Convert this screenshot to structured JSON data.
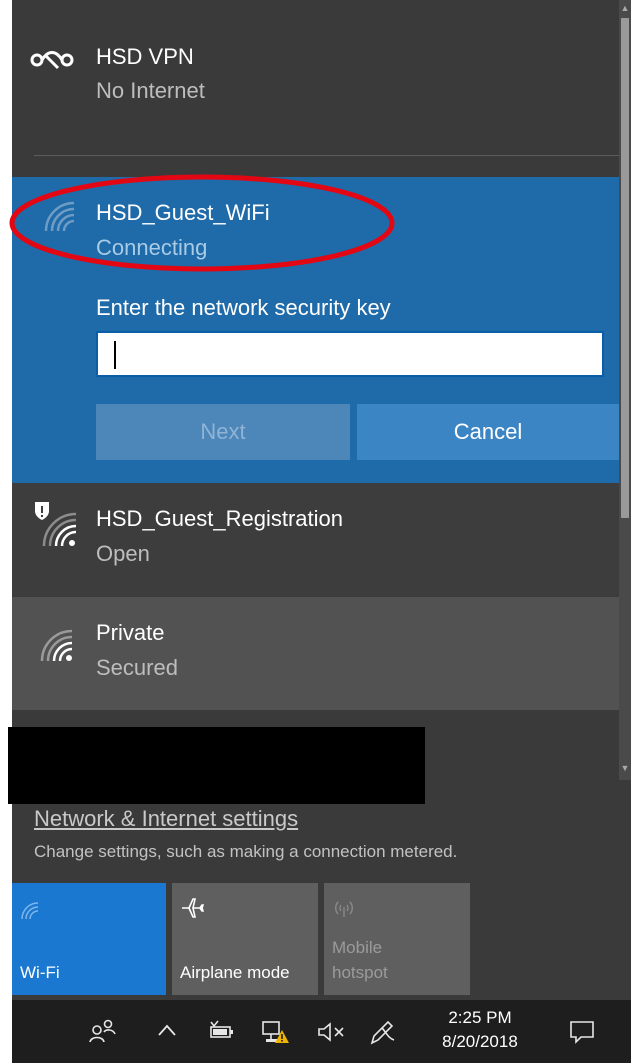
{
  "networks": {
    "vpn": {
      "name": "HSD VPN",
      "status": "No Internet",
      "icon": "vpn-icon"
    },
    "connecting": {
      "name": "HSD_Guest_WiFi",
      "status": "Connecting",
      "icon": "wifi-signal-icon",
      "key_label": "Enter the network security key",
      "key_value": "",
      "next_label": "Next",
      "cancel_label": "Cancel"
    },
    "registration": {
      "name": "HSD_Guest_Registration",
      "status": "Open",
      "icon": "wifi-shield-icon"
    },
    "private": {
      "name": "Private",
      "status": "Secured",
      "icon": "wifi-secured-icon"
    }
  },
  "settings": {
    "link": "Network & Internet settings",
    "description": "Change settings, such as making a connection metered."
  },
  "quick_actions": [
    {
      "label": "Wi-Fi",
      "icon": "wifi-icon",
      "active": true
    },
    {
      "label": "Airplane mode",
      "icon": "airplane-icon",
      "active": false
    },
    {
      "label_line1": "Mobile",
      "label_line2": "hotspot",
      "icon": "hotspot-icon",
      "disabled": true
    }
  ],
  "taskbar": {
    "time": "2:25 PM",
    "date": "8/20/2018",
    "icons": [
      "people-icon",
      "chevron-up-icon",
      "battery-icon",
      "network-warning-icon",
      "volume-muted-icon",
      "pen-icon",
      "action-center-icon"
    ]
  },
  "colors": {
    "flyout_bg": "#3a3a3a",
    "accent": "#1f6aa8",
    "tile_active": "#1a78d0",
    "annotation_red": "#e30613"
  }
}
